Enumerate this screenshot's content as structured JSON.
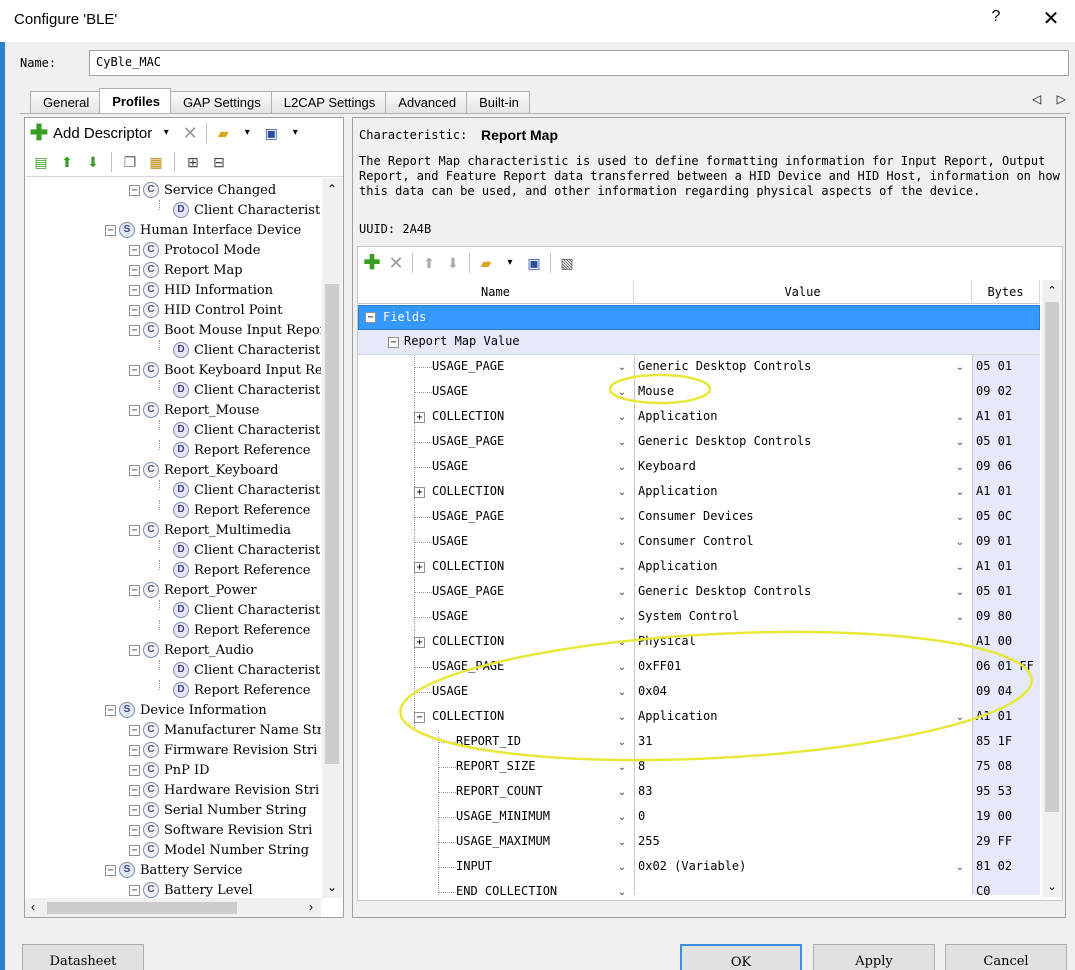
{
  "window": {
    "title": "Configure 'BLE'",
    "help": "?",
    "close": "✕"
  },
  "name": {
    "label": "Name:",
    "value": "CyBle_MAC"
  },
  "tabs": [
    "General",
    "Profiles",
    "GAP Settings",
    "L2CAP Settings",
    "Advanced",
    "Built-in"
  ],
  "active_tab": "Profiles",
  "tab_nav": "◁ ▷",
  "left_toolbar": {
    "add_descriptor": "Add Descriptor"
  },
  "tree": [
    {
      "label": "Service Changed",
      "type": "C",
      "depth": 3
    },
    {
      "label": "Client Characterist",
      "type": "D",
      "depth": 4
    },
    {
      "label": "Human Interface Device",
      "type": "S",
      "depth": 2
    },
    {
      "label": "Protocol Mode",
      "type": "C",
      "depth": 3
    },
    {
      "label": "Report Map",
      "type": "C",
      "depth": 3
    },
    {
      "label": "HID Information",
      "type": "C",
      "depth": 3
    },
    {
      "label": "HID Control Point",
      "type": "C",
      "depth": 3
    },
    {
      "label": "Boot Mouse Input Repor",
      "type": "C",
      "depth": 3
    },
    {
      "label": "Client Characterist",
      "type": "D",
      "depth": 4
    },
    {
      "label": "Boot Keyboard Input Re",
      "type": "C",
      "depth": 3
    },
    {
      "label": "Client Characterist",
      "type": "D",
      "depth": 4
    },
    {
      "label": "Report_Mouse",
      "type": "C",
      "depth": 3
    },
    {
      "label": "Client Characterist",
      "type": "D",
      "depth": 4
    },
    {
      "label": "Report Reference",
      "type": "D",
      "depth": 4
    },
    {
      "label": "Report_Keyboard",
      "type": "C",
      "depth": 3
    },
    {
      "label": "Client Characterist",
      "type": "D",
      "depth": 4
    },
    {
      "label": "Report Reference",
      "type": "D",
      "depth": 4
    },
    {
      "label": "Report_Multimedia",
      "type": "C",
      "depth": 3
    },
    {
      "label": "Client Characterist",
      "type": "D",
      "depth": 4
    },
    {
      "label": "Report Reference",
      "type": "D",
      "depth": 4
    },
    {
      "label": "Report_Power",
      "type": "C",
      "depth": 3
    },
    {
      "label": "Client Characterist",
      "type": "D",
      "depth": 4
    },
    {
      "label": "Report Reference",
      "type": "D",
      "depth": 4
    },
    {
      "label": "Report_Audio",
      "type": "C",
      "depth": 3
    },
    {
      "label": "Client Characterist",
      "type": "D",
      "depth": 4
    },
    {
      "label": "Report Reference",
      "type": "D",
      "depth": 4
    },
    {
      "label": "Device Information",
      "type": "S",
      "depth": 2
    },
    {
      "label": "Manufacturer Name Stri",
      "type": "C",
      "depth": 3
    },
    {
      "label": "Firmware Revision Stri",
      "type": "C",
      "depth": 3
    },
    {
      "label": "PnP ID",
      "type": "C",
      "depth": 3
    },
    {
      "label": "Hardware Revision Stri",
      "type": "C",
      "depth": 3
    },
    {
      "label": "Serial Number String",
      "type": "C",
      "depth": 3
    },
    {
      "label": "Software Revision Stri",
      "type": "C",
      "depth": 3
    },
    {
      "label": "Model Number String",
      "type": "C",
      "depth": 3
    },
    {
      "label": "Battery Service",
      "type": "S",
      "depth": 2
    },
    {
      "label": "Battery Level",
      "type": "C",
      "depth": 3
    }
  ],
  "characteristic": {
    "label": "Characteristic:",
    "name": "Report Map",
    "description": "The Report Map characteristic is used to define formatting information for Input Report, Output Report, and Feature Report data transferred between a HID Device and HID Host, information on how this data can be used, and other information regarding physical aspects of the device.",
    "uuid": "UUID: 2A4B"
  },
  "grid": {
    "headers": [
      "Name",
      "Value",
      "Bytes"
    ],
    "fields_label": "Fields",
    "report_map_value": "Report Map Value",
    "rows": [
      {
        "name": "USAGE_PAGE",
        "value": "Generic Desktop Controls",
        "bytes": "05 01",
        "level": 1,
        "collection": false,
        "has_value_dropdown": true
      },
      {
        "name": "USAGE",
        "value": "Mouse",
        "bytes": "09 02",
        "level": 1,
        "collection": false,
        "has_value_dropdown": false
      },
      {
        "name": "COLLECTION",
        "value": "Application",
        "bytes": "A1 01",
        "level": 1,
        "collection": "plus",
        "has_value_dropdown": true
      },
      {
        "name": "USAGE_PAGE",
        "value": "Generic Desktop Controls",
        "bytes": "05 01",
        "level": 1,
        "collection": false,
        "has_value_dropdown": true
      },
      {
        "name": "USAGE",
        "value": "Keyboard",
        "bytes": "09 06",
        "level": 1,
        "collection": false,
        "has_value_dropdown": true
      },
      {
        "name": "COLLECTION",
        "value": "Application",
        "bytes": "A1 01",
        "level": 1,
        "collection": "plus",
        "has_value_dropdown": true
      },
      {
        "name": "USAGE_PAGE",
        "value": "Consumer Devices",
        "bytes": "05 0C",
        "level": 1,
        "collection": false,
        "has_value_dropdown": true
      },
      {
        "name": "USAGE",
        "value": "Consumer Control",
        "bytes": "09 01",
        "level": 1,
        "collection": false,
        "has_value_dropdown": true
      },
      {
        "name": "COLLECTION",
        "value": "Application",
        "bytes": "A1 01",
        "level": 1,
        "collection": "plus",
        "has_value_dropdown": true
      },
      {
        "name": "USAGE_PAGE",
        "value": "Generic Desktop Controls",
        "bytes": "05 01",
        "level": 1,
        "collection": false,
        "has_value_dropdown": true
      },
      {
        "name": "USAGE",
        "value": "System Control",
        "bytes": "09 80",
        "level": 1,
        "collection": false,
        "has_value_dropdown": true
      },
      {
        "name": "COLLECTION",
        "value": "Physical",
        "bytes": "A1 00",
        "level": 1,
        "collection": "plus",
        "has_value_dropdown": true
      },
      {
        "name": "USAGE_PAGE",
        "value": "0xFF01",
        "bytes": "06 01 FF",
        "level": 1,
        "collection": false,
        "has_value_dropdown": false
      },
      {
        "name": "USAGE",
        "value": "0x04",
        "bytes": "09 04",
        "level": 1,
        "collection": false,
        "has_value_dropdown": false
      },
      {
        "name": "COLLECTION",
        "value": "Application",
        "bytes": "A1 01",
        "level": 1,
        "collection": "minus",
        "has_value_dropdown": true
      },
      {
        "name": "REPORT_ID",
        "value": "31",
        "bytes": "85 1F",
        "level": 2,
        "collection": false,
        "has_value_dropdown": false
      },
      {
        "name": "REPORT_SIZE",
        "value": "8",
        "bytes": "75 08",
        "level": 2,
        "collection": false,
        "has_value_dropdown": false
      },
      {
        "name": "REPORT_COUNT",
        "value": "83",
        "bytes": "95 53",
        "level": 2,
        "collection": false,
        "has_value_dropdown": false
      },
      {
        "name": "USAGE_MINIMUM",
        "value": "0",
        "bytes": "19 00",
        "level": 2,
        "collection": false,
        "has_value_dropdown": false
      },
      {
        "name": "USAGE_MAXIMUM",
        "value": "255",
        "bytes": "29 FF",
        "level": 2,
        "collection": false,
        "has_value_dropdown": false
      },
      {
        "name": "INPUT",
        "value": "0x02 (Variable)",
        "bytes": "81 02",
        "level": 2,
        "collection": false,
        "has_value_dropdown": true
      },
      {
        "name": "END_COLLECTION",
        "value": "",
        "bytes": "C0",
        "level": 2,
        "collection": false,
        "has_value_dropdown": false
      }
    ]
  },
  "buttons": {
    "datasheet": "Datasheet",
    "ok": "OK",
    "apply": "Apply",
    "cancel": "Cancel"
  },
  "colors": {
    "selection": "#3399ff",
    "bytes_bg": "#e6e9fa",
    "annotation": "#e8e83a"
  }
}
